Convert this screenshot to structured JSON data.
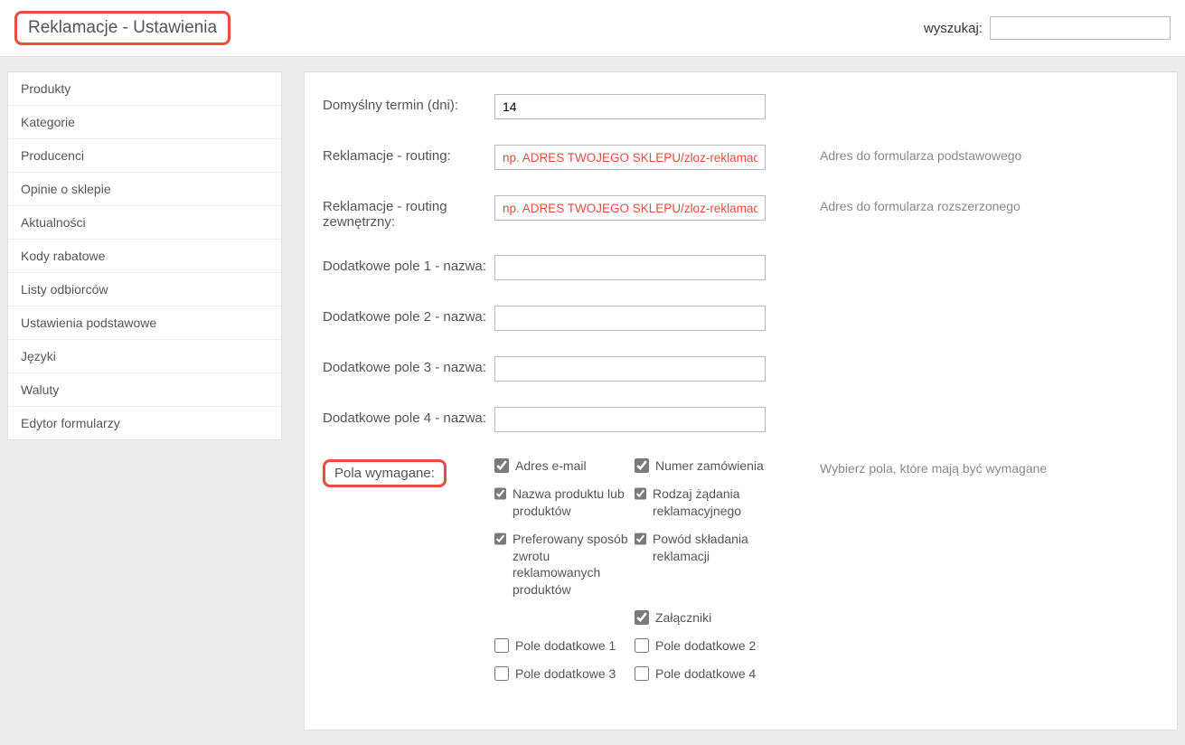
{
  "header": {
    "title": "Reklamacje - Ustawienia",
    "search_label": "wyszukaj:",
    "search_value": ""
  },
  "sidebar": {
    "items": [
      {
        "label": "Produkty"
      },
      {
        "label": "Kategorie"
      },
      {
        "label": "Producenci"
      },
      {
        "label": "Opinie o sklepie"
      },
      {
        "label": "Aktualności"
      },
      {
        "label": "Kody rabatowe"
      },
      {
        "label": "Listy odbiorców"
      },
      {
        "label": "Ustawienia podstawowe"
      },
      {
        "label": "Języki"
      },
      {
        "label": "Waluty"
      },
      {
        "label": "Edytor formularzy"
      }
    ]
  },
  "form": {
    "default_term": {
      "label": "Domyślny termin (dni):",
      "value": "14",
      "help": ""
    },
    "routing": {
      "label": "Reklamacje - routing:",
      "value": "",
      "placeholder": "np. ADRES TWOJEGO SKLEPU/zloz-reklamacje",
      "help": "Adres do formularza podstawowego"
    },
    "routing_ext": {
      "label": "Reklamacje - routing zewnętrzny:",
      "value": "",
      "placeholder": "np. ADRES TWOJEGO SKLEPU/zloz-reklamacje-formularz",
      "help": "Adres do formularza rozszerzonego"
    },
    "extra1": {
      "label": "Dodatkowe pole 1 - nazwa:",
      "value": ""
    },
    "extra2": {
      "label": "Dodatkowe pole 2 - nazwa:",
      "value": ""
    },
    "extra3": {
      "label": "Dodatkowe pole 3 - nazwa:",
      "value": ""
    },
    "extra4": {
      "label": "Dodatkowe pole 4 - nazwa:",
      "value": ""
    },
    "required": {
      "label": "Pola wymagane:",
      "help": "Wybierz pola, które mają być wymagane",
      "options": [
        {
          "label": "Adres e-mail",
          "checked": true
        },
        {
          "label": "Numer zamówienia",
          "checked": true
        },
        {
          "label": "Nazwa produktu lub produktów",
          "checked": true
        },
        {
          "label": "Rodzaj żądania reklamacyjnego",
          "checked": true
        },
        {
          "label": "Preferowany sposób zwrotu reklamowanych produktów",
          "checked": true
        },
        {
          "label": "Powód składania reklamacji",
          "checked": true
        },
        {
          "label": "Załączniki",
          "checked": true,
          "col2only": true
        },
        {
          "label": "Pole dodatkowe 1",
          "checked": false
        },
        {
          "label": "Pole dodatkowe 2",
          "checked": false
        },
        {
          "label": "Pole dodatkowe 3",
          "checked": false
        },
        {
          "label": "Pole dodatkowe 4",
          "checked": false
        }
      ]
    }
  }
}
